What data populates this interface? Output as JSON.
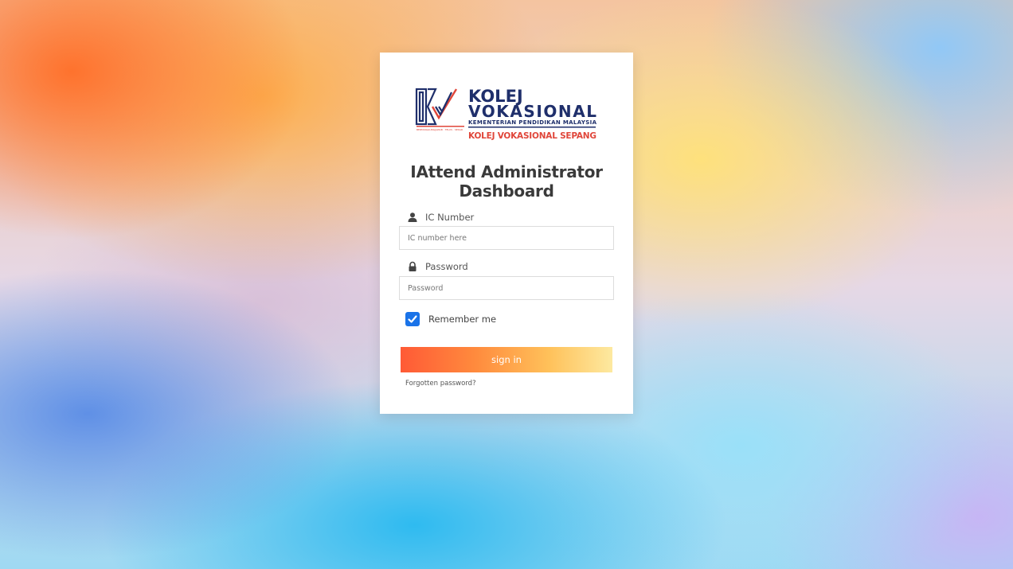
{
  "logo": {
    "line1": "KOLEJ",
    "line2": "VOKASIONAL",
    "line3": "KEMENTERIAN PENDIDIKAN MALAYSIA",
    "line4": "KOLEJ VOKASIONAL SEPANG",
    "navy": "#1f2f6b",
    "red": "#e0463a"
  },
  "title": {
    "line1": "IAttend Administrator",
    "line2": "Dashboard"
  },
  "form": {
    "ic_label": "IC Number",
    "ic_icon": "user-icon",
    "ic_placeholder": "IC number here",
    "password_label": "Password",
    "password_icon": "lock-icon",
    "password_placeholder": "Password",
    "remember_label": "Remember me",
    "remember_checked": true,
    "signin_label": "sign in",
    "forgot_label": "Forgotten password?"
  },
  "colors": {
    "checkbox": "#1a73e8",
    "button_gradient_start": "#ff5a36",
    "button_gradient_end": "#fde9a0"
  }
}
